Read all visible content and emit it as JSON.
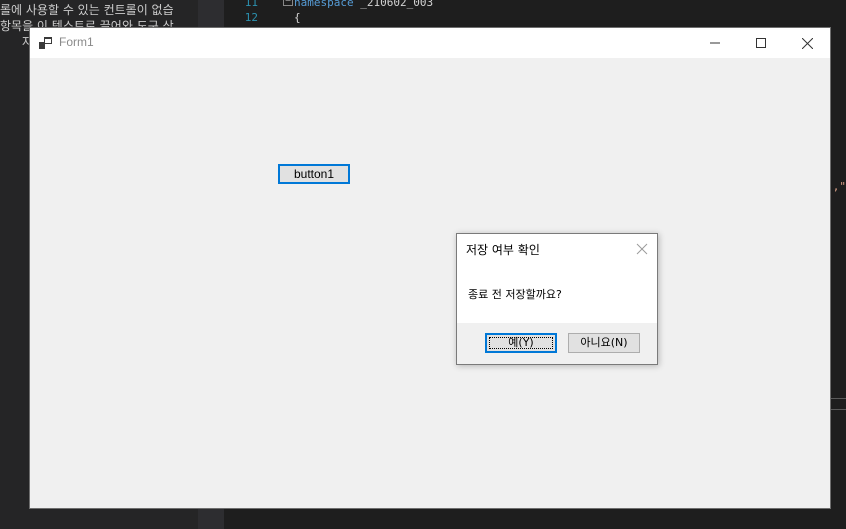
{
  "ide": {
    "solution_explorer_lines": [
      "롤에 사용할 수 있는 컨트롤이 없습",
      "항목을 이 텍스트로 끌어와 도구 상",
      "자"
    ],
    "line_numbers": [
      "11",
      "12"
    ],
    "code_line_11_keyword": "namespace",
    "code_line_11_name": "_210602_003",
    "code_line_12": "{",
    "right_fragment": "\",\""
  },
  "form1": {
    "title": "Form1",
    "button1_label": "button1",
    "caption_icons": [
      "minimize-icon",
      "maximize-icon",
      "close-icon"
    ]
  },
  "message_box": {
    "title": "저장 여부 확인",
    "message": "종료 전 저장할까요?",
    "yes_label": "예(Y)",
    "no_label": "아니요(N)"
  },
  "colors": {
    "accent": "#0078d7",
    "form_background": "#f0f0f0",
    "ide_background": "#1e1e1e"
  }
}
